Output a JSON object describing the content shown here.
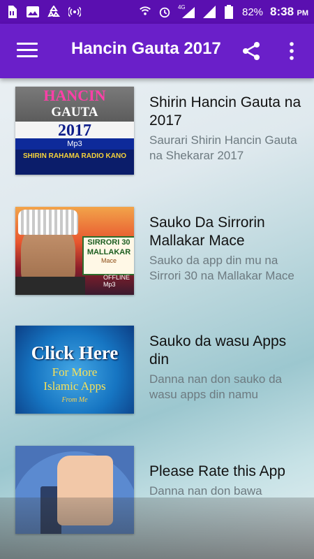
{
  "status_bar": {
    "battery_percent": "82%",
    "time": "8:38",
    "ampm": "PM",
    "network_label": "4G"
  },
  "app_bar": {
    "title": "Hancin Gauta 2017"
  },
  "thumbnails": {
    "t1_line1": "HANCIN",
    "t1_line2": "GAUTA",
    "t1_line3": "2017",
    "t1_line4": "Mp3",
    "t1_line5": "SHIRIN RAHAMA RADIO KANO",
    "t2_line1": "SIRRORI 30",
    "t2_line2": "MALLAKAR",
    "t2_line3": "Mace",
    "t2_line4": "OFFLINE Mp3",
    "t3_line1": "Click Here",
    "t3_line2": "For More",
    "t3_line3": "Islamic Apps",
    "t3_line4": "From Me"
  },
  "list_items": [
    {
      "title": "Shirin Hancin Gauta na 2017",
      "subtitle": "Saurari Shirin Hancin Gauta na Shekarar 2017"
    },
    {
      "title": "Sauko Da Sirrorin Mallakar Mace",
      "subtitle": "Sauko da app din mu na Sirrori 30 na Mallakar Mace"
    },
    {
      "title": "Sauko da wasu Apps din",
      "subtitle": "Danna nan don sauko da wasu apps din namu"
    },
    {
      "title": "Please Rate this App",
      "subtitle": "Danna nan don bawa"
    }
  ],
  "colors": {
    "status_bar": "#5a0fb0",
    "app_bar": "#6a1fc9"
  }
}
